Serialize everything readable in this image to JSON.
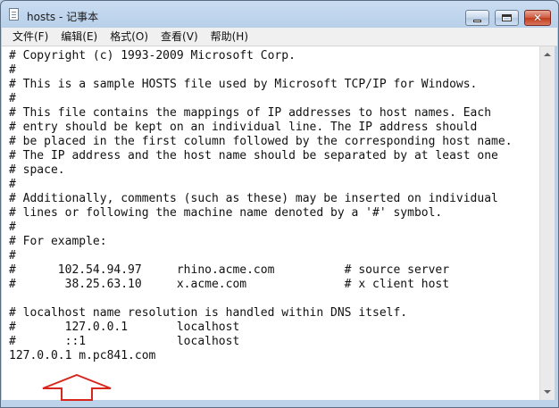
{
  "window": {
    "title": "hosts - 记事本",
    "icon": "notepad-icon",
    "controls": {
      "minimize": "minimize-icon",
      "maximize": "maximize-icon",
      "close": "close-icon"
    }
  },
  "menu": {
    "items": [
      {
        "label": "文件(F)"
      },
      {
        "label": "编辑(E)"
      },
      {
        "label": "格式(O)"
      },
      {
        "label": "查看(V)"
      },
      {
        "label": "帮助(H)"
      }
    ]
  },
  "editor": {
    "lines": [
      "# Copyright (c) 1993-2009 Microsoft Corp.",
      "#",
      "# This is a sample HOSTS file used by Microsoft TCP/IP for Windows.",
      "#",
      "# This file contains the mappings of IP addresses to host names. Each",
      "# entry should be kept on an individual line. The IP address should",
      "# be placed in the first column followed by the corresponding host name.",
      "# The IP address and the host name should be separated by at least one",
      "# space.",
      "#",
      "# Additionally, comments (such as these) may be inserted on individual",
      "# lines or following the machine name denoted by a '#' symbol.",
      "#",
      "# For example:",
      "#",
      "#      102.54.94.97     rhino.acme.com          # source server",
      "#       38.25.63.10     x.acme.com              # x client host",
      "",
      "# localhost name resolution is handled within DNS itself.",
      "#       127.0.0.1       localhost",
      "#       ::1             localhost",
      "127.0.0.1 m.pc841.com"
    ]
  },
  "annotation": {
    "color": "#d9261c",
    "shape": "up-arrow"
  },
  "scrollbar": {
    "up_icon": "scroll-up-icon",
    "down_icon": "scroll-down-icon"
  }
}
